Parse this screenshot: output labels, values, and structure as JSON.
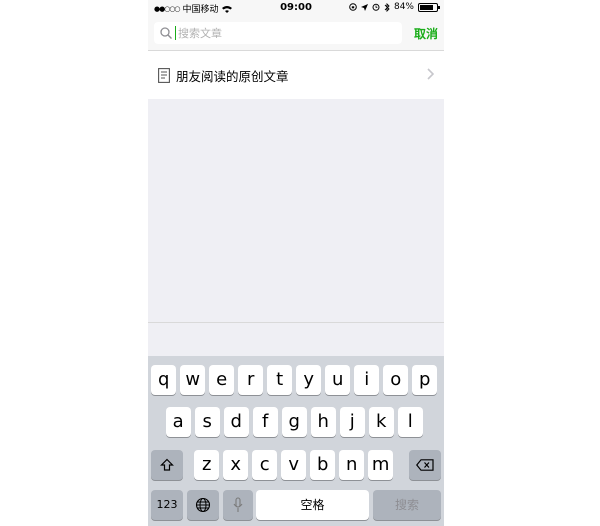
{
  "status_bar": {
    "carrier": "中国移动",
    "time": "09:00",
    "battery": "84%",
    "battery_level": 0.84
  },
  "search": {
    "placeholder": "搜索文章",
    "cancel_label": "取消"
  },
  "result": {
    "label": "朋友阅读的原创文章"
  },
  "keyboard": {
    "row1": [
      "q",
      "w",
      "e",
      "r",
      "t",
      "y",
      "u",
      "i",
      "o",
      "p"
    ],
    "row2": [
      "a",
      "s",
      "d",
      "f",
      "g",
      "h",
      "j",
      "k",
      "l"
    ],
    "row3": [
      "z",
      "x",
      "c",
      "v",
      "b",
      "n",
      "m"
    ],
    "numbers_label": "123",
    "space_label": "空格",
    "search_label": "搜索"
  },
  "colors": {
    "accent": "#1aad19",
    "background": "#efeff4",
    "keyboard": "#d1d5db"
  },
  "icons": {
    "signal": "signal-dots-icon",
    "wifi": "wifi-icon",
    "lock": "orientation-lock-icon",
    "location": "location-arrow-icon",
    "alarm": "alarm-icon",
    "bluetooth": "bluetooth-icon",
    "battery": "battery-icon",
    "search": "search-icon",
    "document": "document-icon",
    "chevron": "chevron-right-icon",
    "shift": "shift-icon",
    "delete": "delete-icon",
    "globe": "globe-icon",
    "mic": "microphone-icon"
  }
}
